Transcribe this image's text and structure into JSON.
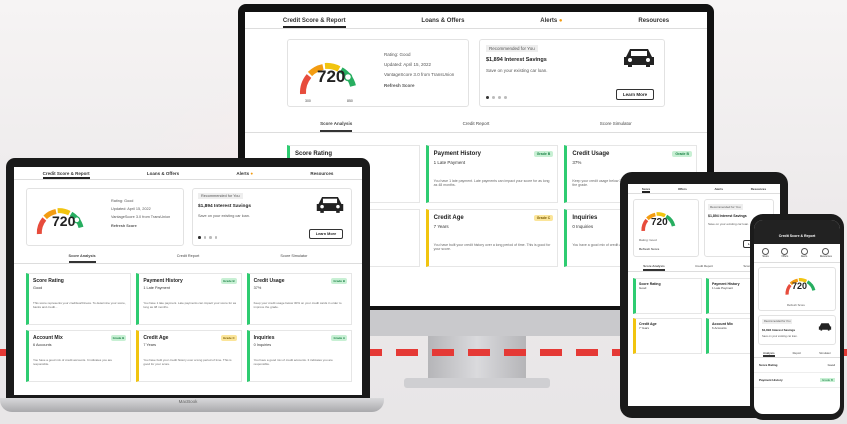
{
  "tabs": [
    "Credit Score & Report",
    "Loans & Offers",
    "Alerts",
    "Resources"
  ],
  "alert_dot": "●",
  "score": {
    "value": "720",
    "rating": "Rating: Good",
    "updated": "Updated: April 15, 2022",
    "source": "VantageScore 3.0 from TransUnion",
    "refresh": "Refresh Score",
    "low": "300",
    "high": "850"
  },
  "offer": {
    "tag": "Recommended for You",
    "title": "$1,894 Interest Savings",
    "text": "Save on your existing car loan.",
    "button": "Learn More"
  },
  "subtabs": [
    "Score Analysis",
    "Credit Report",
    "Score Simulator"
  ],
  "tiles": [
    {
      "title": "Score Rating",
      "value": "Good",
      "badge": "",
      "desc": "This score represents your creditworthiness. To determine your score, banks and credit..."
    },
    {
      "title": "Payment History",
      "value": "1 Late Payment",
      "badge": "Grade B",
      "desc": "You have 1 late payment. Late payments can impact your score for as long as 48 months."
    },
    {
      "title": "Credit Usage",
      "value": "37%",
      "badge": "Grade B",
      "desc": "Keep your credit usage below 30% on your credit cards in order to improve the grade."
    },
    {
      "title": "Account Mix",
      "value": "6 Accounts",
      "badge": "Grade B",
      "desc": "You have a good mix of credit accounts. It indicates you are responsible."
    },
    {
      "title": "Credit Age",
      "value": "7 Years",
      "badge": "Grade C",
      "desc": "You have built your credit history over a long period of time. This is good for your score."
    },
    {
      "title": "Inquiries",
      "value": "0 Inquiries",
      "badge": "Grade A",
      "desc": "You have a good mix of credit accounts. It indicates you are responsible."
    }
  ],
  "laptop_brand": "MacBook",
  "phone": {
    "header": "Credit Score & Report",
    "icons": [
      "Score",
      "Offers",
      "Alerts",
      "Resources"
    ],
    "subtabs": [
      "Analysis",
      "Report",
      "Simulator"
    ],
    "rows": [
      {
        "label": "Score Rating",
        "value": "Good"
      },
      {
        "label": "Payment History",
        "value": "Grade B"
      }
    ]
  },
  "colors": {
    "accent": "#e53935",
    "good": "#2ecc71",
    "warn": "#f1c40f",
    "gauge_red": "#e74c3c",
    "gauge_orange": "#f39c12",
    "gauge_yellow": "#f1c40f",
    "gauge_green": "#27ae60"
  }
}
